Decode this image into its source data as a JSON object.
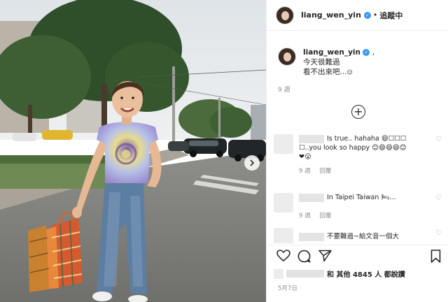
{
  "post": {
    "username": "liang_wen_yin",
    "follow_status": "追蹤中",
    "separator": "•",
    "caption_lines": [
      "今天很難過",
      "看不出來吧...",
      "😑"
    ],
    "caption_age": "9 週",
    "date": "5月7日",
    "likes_text": "和 其他 4845 人 都說讚"
  },
  "comments": [
    {
      "lines": [
        "Is true.. hahaha 😄☐☐☐",
        "☐..you look so happy 😊😄😄😄😊",
        "❤😮"
      ],
      "age": "9 週",
      "reply_label": "回覆"
    },
    {
      "lines": [
        "In Taipei Taiwan 🛏..."
      ],
      "age": "9 週",
      "reply_label": "回覆"
    },
    {
      "lines": [
        "不要難過~給文音一個大"
      ],
      "age": "",
      "reply_label": ""
    }
  ],
  "icons": {
    "verified": "verified-badge",
    "load_more": "plus-circle-icon",
    "like": "heart-icon",
    "comment": "comment-icon",
    "share": "paper-plane-icon",
    "save": "bookmark-icon",
    "next": "chevron-right-icon"
  },
  "colors": {
    "verified": "#3897f0",
    "text": "#262626",
    "muted": "#8e8e8e"
  }
}
